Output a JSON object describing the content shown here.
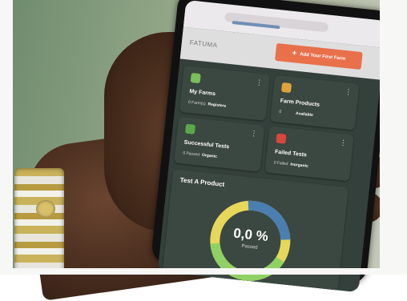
{
  "app": {
    "user_name": "FATUMA",
    "add_farm_button": "Add Your First Farm"
  },
  "cards": {
    "farms": {
      "title": "My Farms",
      "count": "0 Farm(s)",
      "status": "Registere"
    },
    "products": {
      "title": "Farm Products",
      "count": "0",
      "status": "Available"
    },
    "successful": {
      "title": "Successful Tests",
      "count": "0 Passed",
      "status": "Organic"
    },
    "failed": {
      "title": "Failed Tests",
      "count": "0 Failed",
      "status": "Inorganic"
    }
  },
  "test_product": {
    "title": "Test A Product",
    "percent_text": "0,0 %",
    "label": "Passed",
    "passed_fraction": 0.0
  },
  "colors": {
    "accent_orange": "#e8704a",
    "card_bg": "#3b4741",
    "screen_bg": "#34403b",
    "gauge_green": "#8fd163",
    "gauge_yellow": "#e6d75a",
    "gauge_blue": "#4a7fb0",
    "farms_icon": "#7bbf5a",
    "products_icon": "#e0a33a",
    "success_icon": "#5aa84a",
    "failed_icon": "#d9463e"
  },
  "icons": {
    "farms": "leaf-icon",
    "products": "box-icon",
    "successful": "check-icon",
    "failed": "x-icon",
    "menu": "more-vertical-icon",
    "add": "plus-icon"
  }
}
